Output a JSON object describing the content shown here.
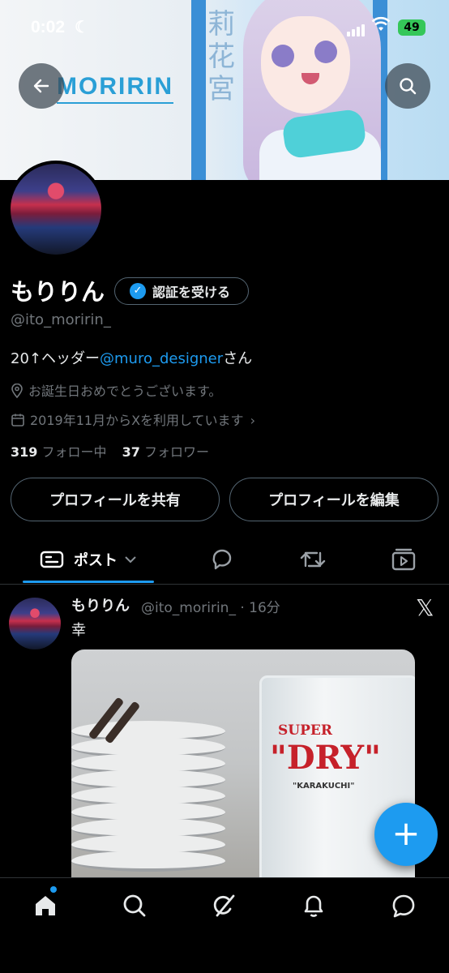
{
  "status_bar": {
    "time": "0:02",
    "battery": "49"
  },
  "banner": {
    "logo_text": "MORIRIN",
    "side_text": "莉花宮"
  },
  "profile": {
    "display_name": "もりりん",
    "verify_label": "認証を受ける",
    "handle": "@ito_moririn_",
    "bio_prefix": "20↑ヘッダー",
    "bio_link": "@muro_designer",
    "bio_suffix": "さん",
    "location": "お誕生日おめでとうございます。",
    "joined": "2019年11月からXを利用しています",
    "following_count": "319",
    "following_label": "フォロー中",
    "followers_count": "37",
    "followers_label": "フォロワー"
  },
  "actions": {
    "share_label": "プロフィールを共有",
    "edit_label": "プロフィールを編集"
  },
  "tabs": {
    "posts_label": "ポスト"
  },
  "post": {
    "name": "もりりん",
    "handle_time": "@ito_moririn_ · 16分",
    "text": "幸",
    "photo": {
      "glass_brand_top": "SUPER",
      "glass_brand": "\"DRY\"",
      "glass_sub": "\"KARAKUCHI\""
    }
  },
  "fab_label": "+",
  "colors": {
    "accent": "#1d9bf0",
    "background": "#000000",
    "muted": "#71767b"
  },
  "icons": [
    "back-arrow-icon",
    "search-icon",
    "verified-badge-icon",
    "location-pin-icon",
    "calendar-icon",
    "chevron-right-icon",
    "posts-tab-icon",
    "chevron-down-icon",
    "reply-icon",
    "repost-icon",
    "media-icon",
    "x-logo-icon",
    "home-icon",
    "grok-icon",
    "bell-icon",
    "messages-icon"
  ]
}
